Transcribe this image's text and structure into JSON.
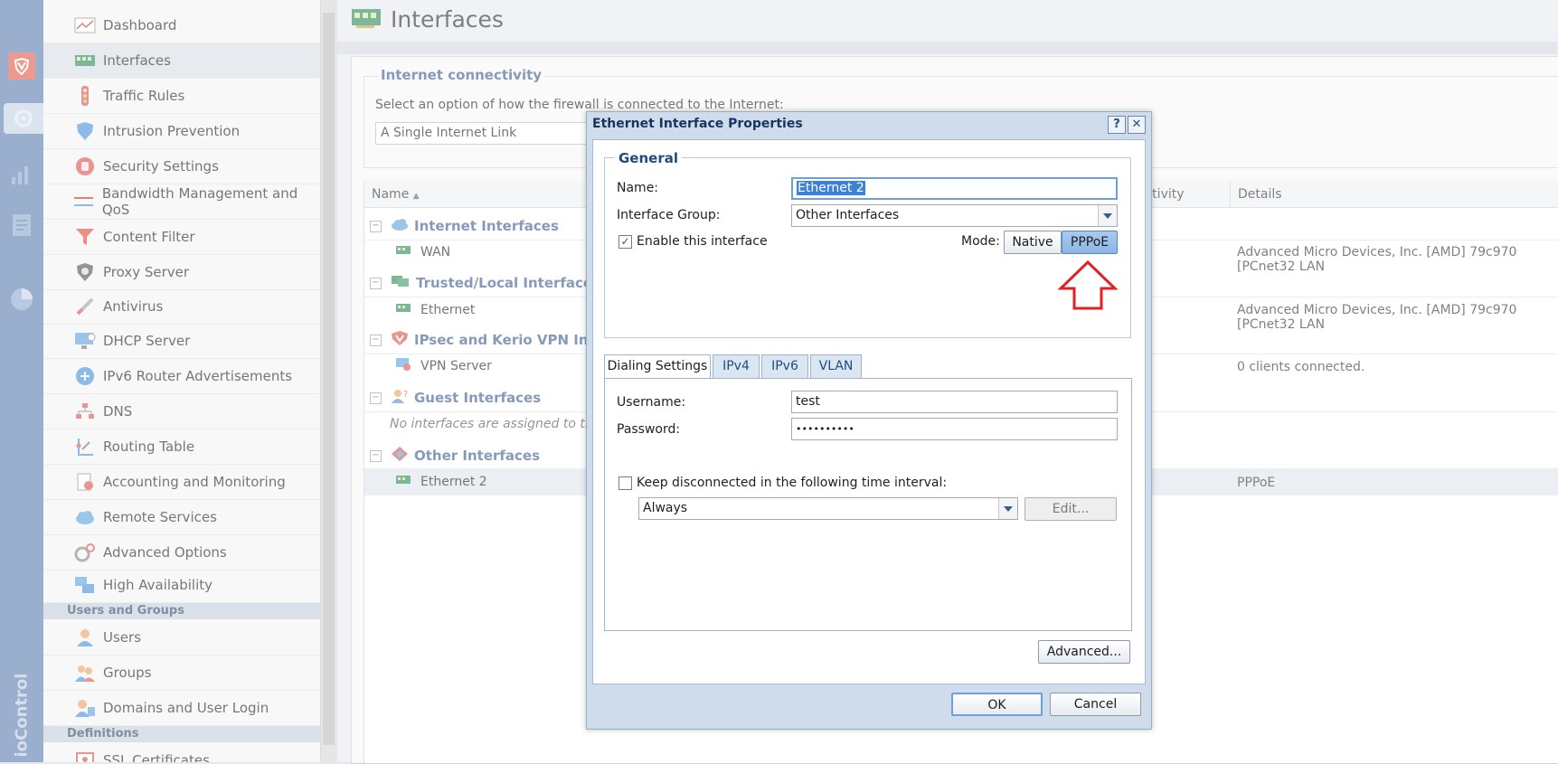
{
  "rail": {
    "brand": "ioControl",
    "icons": [
      "kerio-shield-icon",
      "gear-icon",
      "bar-chart-icon",
      "logs-icon",
      "pie-chart-icon"
    ]
  },
  "sidebar": {
    "items": [
      {
        "label": "Dashboard",
        "icon": "dashboard-icon"
      },
      {
        "label": "Interfaces",
        "icon": "network-card-icon"
      },
      {
        "label": "Traffic Rules",
        "icon": "traffic-light-icon"
      },
      {
        "label": "Intrusion Prevention",
        "icon": "shield-icon"
      },
      {
        "label": "Security Settings",
        "icon": "hand-stop-icon"
      },
      {
        "label": "Bandwidth Management and QoS",
        "icon": "bandwidth-icon"
      },
      {
        "label": "Content Filter",
        "icon": "funnel-icon"
      },
      {
        "label": "Proxy Server",
        "icon": "proxy-icon"
      },
      {
        "label": "Antivirus",
        "icon": "syringe-icon"
      },
      {
        "label": "DHCP Server",
        "icon": "dhcp-icon"
      },
      {
        "label": "IPv6 Router Advertisements",
        "icon": "router-icon"
      },
      {
        "label": "DNS",
        "icon": "dns-icon"
      },
      {
        "label": "Routing Table",
        "icon": "routing-icon"
      },
      {
        "label": "Accounting and Monitoring",
        "icon": "accounting-icon"
      },
      {
        "label": "Remote Services",
        "icon": "cloud-icon"
      },
      {
        "label": "Advanced Options",
        "icon": "gears-icon"
      },
      {
        "label": "High Availability",
        "icon": "ha-icon"
      }
    ],
    "section_users": "Users and Groups",
    "users_items": [
      {
        "label": "Users",
        "icon": "user-icon"
      },
      {
        "label": "Groups",
        "icon": "group-icon"
      },
      {
        "label": "Domains and User Login",
        "icon": "domain-icon"
      }
    ],
    "section_definitions": "Definitions",
    "definitions_items": [
      {
        "label": "SSL Certificates",
        "icon": "certificate-icon"
      }
    ]
  },
  "page": {
    "title": "Interfaces",
    "connectivity_legend": "Internet connectivity",
    "connectivity_desc": "Select an option of how the firewall is connected to the Internet:",
    "connectivity_value": "A Single Internet Link"
  },
  "grid": {
    "columns": {
      "name": "Name",
      "connectivity": "nectivity",
      "details": "Details"
    },
    "groups": {
      "internet": "Internet Interfaces",
      "trusted": "Trusted/Local Interfaces",
      "vpn": "IPsec and Kerio VPN Interfa",
      "guest": "Guest Interfaces",
      "other": "Other Interfaces"
    },
    "rows": {
      "wan": "WAN",
      "ethernet": "Ethernet",
      "vpn_server": "VPN Server",
      "guest_empty": "No interfaces are assigned to this g",
      "ethernet2": "Ethernet 2"
    },
    "details": {
      "wan": "Advanced Micro Devices, Inc. [AMD] 79c970 [PCnet32 LAN",
      "ethernet": "Advanced Micro Devices, Inc. [AMD] 79c970 [PCnet32 LAN",
      "vpn_server": "0 clients connected.",
      "ethernet2": "PPPoE"
    }
  },
  "dialog": {
    "title": "Ethernet Interface Properties",
    "help": "?",
    "close": "✕",
    "general_legend": "General",
    "name_label": "Name:",
    "name_value": "Ethernet 2",
    "group_label": "Interface Group:",
    "group_value": "Other Interfaces",
    "enable_label": "Enable this interface",
    "enable_checked": true,
    "mode_label": "Mode:",
    "mode_native": "Native",
    "mode_pppoe": "PPPoE",
    "tabs": [
      "Dialing Settings",
      "IPv4",
      "IPv6",
      "VLAN"
    ],
    "username_label": "Username:",
    "username_value": "test",
    "password_label": "Password:",
    "password_value": "••••••••••",
    "keep_label": "Keep disconnected in the following time interval:",
    "interval_value": "Always",
    "edit_button": "Edit...",
    "advanced_button": "Advanced...",
    "ok_button": "OK",
    "cancel_button": "Cancel"
  },
  "colors": {
    "rail": "#5b7fae",
    "accent": "#3c5d8f",
    "annotation_arrow": "#e32020"
  }
}
